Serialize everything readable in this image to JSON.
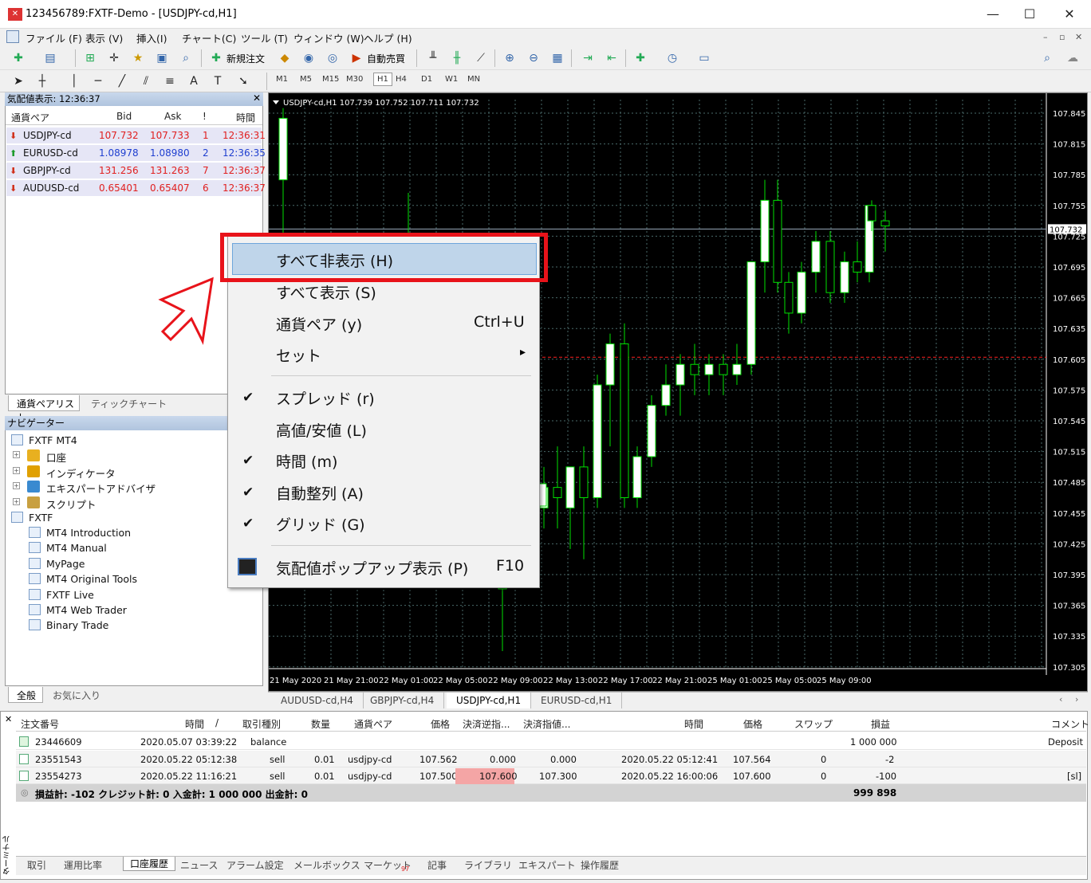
{
  "window": {
    "title": "123456789:FXTF-Demo - [USDJPY-cd,H1]",
    "minimize": "—",
    "maximize": "☐",
    "close": "✕"
  },
  "menu": [
    "ファイル (F)",
    "表示 (V)",
    "挿入(I)",
    "チャート(C)",
    "ツール (T)",
    "ウィンドウ (W)",
    "ヘルプ (H)"
  ],
  "toolbar": {
    "new_order": "新規注文",
    "auto_trade": "自動売買"
  },
  "timeframes": [
    "M1",
    "M5",
    "M15",
    "M30",
    "H1",
    "H4",
    "D1",
    "W1",
    "MN"
  ],
  "market_watch": {
    "title": "気配値表示: 12:36:37",
    "headers": [
      "通貨ペア",
      "Bid",
      "Ask",
      "!",
      "時間"
    ],
    "rows": [
      {
        "symbol": "USDJPY-cd",
        "bid": "107.732",
        "ask": "107.733",
        "spread": "1",
        "time": "12:36:31",
        "dir": "down"
      },
      {
        "symbol": "EURUSD-cd",
        "bid": "1.08978",
        "ask": "1.08980",
        "spread": "2",
        "time": "12:36:35",
        "dir": "up"
      },
      {
        "symbol": "GBPJPY-cd",
        "bid": "131.256",
        "ask": "131.263",
        "spread": "7",
        "time": "12:36:37",
        "dir": "down"
      },
      {
        "symbol": "AUDUSD-cd",
        "bid": "0.65401",
        "ask": "0.65407",
        "spread": "6",
        "time": "12:36:37",
        "dir": "down"
      }
    ],
    "tabs": [
      "通貨ペアリスト",
      "ティックチャート"
    ]
  },
  "navigator": {
    "title": "ナビゲーター",
    "root": "FXTF MT4",
    "items": [
      "口座",
      "インディケータ",
      "エキスパートアドバイザ",
      "スクリプト"
    ],
    "folder": "FXTF",
    "links": [
      "MT4 Introduction",
      "MT4 Manual",
      "MyPage",
      "MT4 Original Tools",
      "FXTF Live",
      "MT4 Web Trader",
      "Binary Trade"
    ],
    "tabs": [
      "全般",
      "お気に入り"
    ]
  },
  "chart": {
    "header": "USDJPY-cd,H1  107.739 107.752 107.711 107.732",
    "price_labels": [
      "107.845",
      "107.815",
      "107.785",
      "107.755",
      "107.725",
      "107.695",
      "107.665",
      "107.635",
      "107.605",
      "107.575",
      "107.545",
      "107.515",
      "107.485",
      "107.455",
      "107.425",
      "107.395",
      "107.365",
      "107.335",
      "107.305"
    ],
    "current_price": "107.732",
    "time_labels": [
      "21 May 2020",
      "21 May 21:00",
      "22 May 01:00",
      "22 May 05:00",
      "22 May 09:00",
      "22 May 13:00",
      "22 May 17:00",
      "22 May 21:00",
      "25 May 01:00",
      "25 May 05:00",
      "25 May 09:00"
    ],
    "tabs": [
      "AUDUSD-cd,H4",
      "GBPJPY-cd,H4",
      "USDJPY-cd,H1",
      "EURUSD-cd,H1"
    ],
    "active_tab": "USDJPY-cd,H1"
  },
  "context_menu": {
    "items": [
      {
        "label": "すべて非表示 (H)",
        "highlighted": true
      },
      {
        "label": "すべて表示 (S)"
      },
      {
        "label": "通貨ペア (y)",
        "shortcut": "Ctrl+U"
      },
      {
        "label": "セット",
        "submenu": "▸"
      },
      {
        "label": "スプレッド (r)",
        "checked": "✔"
      },
      {
        "label": "高値/安値 (L)"
      },
      {
        "label": "時間 (m)",
        "checked": "✔"
      },
      {
        "label": "自動整列 (A)",
        "checked": "✔"
      },
      {
        "label": "グリッド (G)",
        "checked": "✔"
      },
      {
        "label": "気配値ポップアップ表示 (P)",
        "shortcut": "F10"
      }
    ]
  },
  "terminal": {
    "headers": [
      "注文番号",
      "時間",
      "/",
      "取引種別",
      "数量",
      "通貨ペア",
      "価格",
      "決済逆指...",
      "決済指値...",
      "時間",
      "価格",
      "スワップ",
      "損益",
      "コメント"
    ],
    "rows": [
      {
        "id": "23446609",
        "time": "2020.05.07 03:39:22",
        "type": "balance",
        "profit": "1 000 000",
        "comment": "Deposit"
      },
      {
        "id": "23551543",
        "time": "2020.05.22 05:12:38",
        "type": "sell",
        "size": "0.01",
        "symbol": "usdjpy-cd",
        "price": "107.562",
        "sl": "0.000",
        "tp": "0.000",
        "close_time": "2020.05.22 05:12:41",
        "close_price": "107.564",
        "swap": "0",
        "profit": "-2",
        "comment": ""
      },
      {
        "id": "23554273",
        "time": "2020.05.22 11:16:21",
        "type": "sell",
        "size": "0.01",
        "symbol": "usdjpy-cd",
        "price": "107.500",
        "sl": "107.600",
        "tp": "107.300",
        "close_time": "2020.05.22 16:00:06",
        "close_price": "107.600",
        "swap": "0",
        "profit": "-100",
        "comment": "[sl]"
      }
    ],
    "summary": "損益計: -102  クレジット計: 0  入金計: 1 000 000  出金計: 0",
    "summary_total": "999 898",
    "side_label": "ターミナル",
    "tabs": [
      "取引",
      "運用比率",
      "口座履歴",
      "ニュース",
      "アラーム設定",
      "メールボックス",
      "マーケット",
      "記事",
      "ライブラリ",
      "エキスパート",
      "操作履歴"
    ],
    "market_badge": "97",
    "active_tab": "口座履歴"
  },
  "colors": {
    "bull": "#ffffff",
    "bear": "#000000",
    "wick": "#00e000",
    "grid": "#4a6a6a",
    "bid_line": "#ff2020",
    "highlight": "#e8131a"
  }
}
